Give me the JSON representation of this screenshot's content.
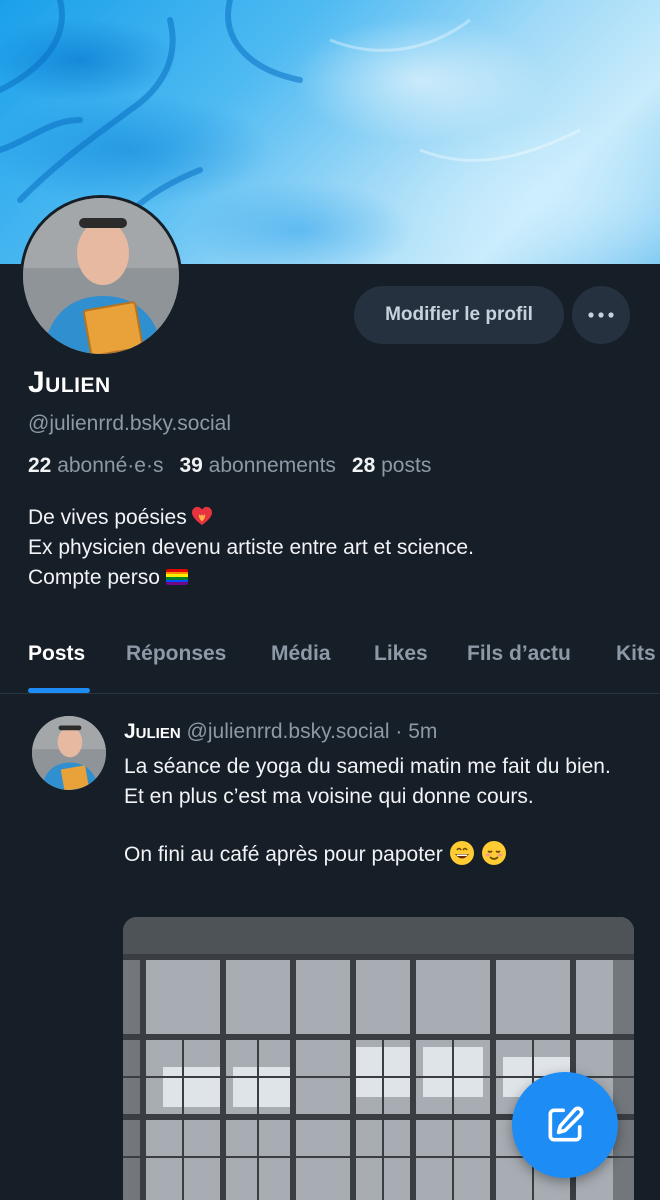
{
  "profile": {
    "name": "Julien",
    "handle": "@julienrrd.bsky.social",
    "followers_count": "22",
    "followers_label": "abonné·e·s",
    "following_count": "39",
    "following_label": "abonnements",
    "posts_count": "28",
    "posts_label": "posts",
    "bio": {
      "line1": "De vives poésies",
      "line2": "Ex physicien devenu artiste entre art et science.",
      "line3": "Compte perso"
    },
    "edit_button": "Modifier le profil",
    "more_icon": "ellipsis-icon"
  },
  "tabs": [
    {
      "label": "Posts",
      "active": true
    },
    {
      "label": "Réponses"
    },
    {
      "label": "Média"
    },
    {
      "label": "Likes"
    },
    {
      "label": "Fils d’actu"
    },
    {
      "label": "Kits"
    }
  ],
  "post": {
    "author": "Julien",
    "handle": "@julienrrd.bsky.social",
    "separator": "·",
    "time": "5m",
    "text1": "La séance de yoga du samedi matin me fait du bien. Et en plus c’est ma voisine qui donne cours.",
    "text2": "On fini au café après pour papoter"
  },
  "fab": {
    "icon": "compose-icon"
  },
  "colors": {
    "background": "#161e27",
    "accent": "#1d8cf5",
    "muted_text": "#8d99a6",
    "button_bg": "#263140"
  }
}
